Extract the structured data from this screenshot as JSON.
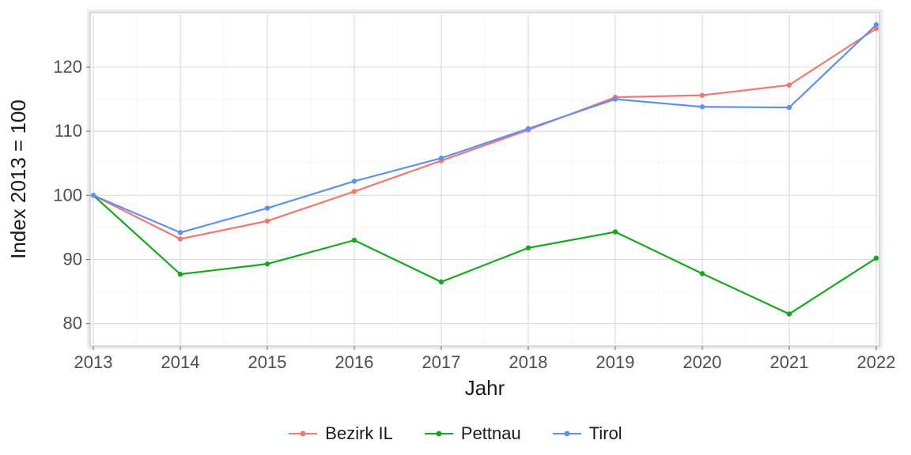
{
  "chart_data": {
    "type": "line",
    "xlabel": "Jahr",
    "ylabel": "Index  2013  = 100",
    "x": [
      2013,
      2014,
      2015,
      2016,
      2017,
      2018,
      2019,
      2020,
      2021,
      2022
    ],
    "ylim": [
      77,
      128
    ],
    "y_ticks": [
      80,
      90,
      100,
      110,
      120
    ],
    "series": [
      {
        "name": "Bezirk IL",
        "color": "#f5766e",
        "values": [
          100,
          93.2,
          96.0,
          100.6,
          105.4,
          110.2,
          115.3,
          115.6,
          117.2,
          126.0
        ]
      },
      {
        "name": "Pettnau",
        "color": "#14a81c",
        "values": [
          100,
          87.7,
          89.3,
          93.0,
          86.5,
          91.8,
          94.3,
          87.8,
          81.5,
          90.2
        ]
      },
      {
        "name": "Tirol",
        "color": "#5e90f2",
        "values": [
          100,
          94.2,
          98.0,
          102.2,
          105.8,
          110.4,
          115.0,
          113.8,
          113.7,
          126.6
        ]
      }
    ],
    "legend_position": "bottom"
  }
}
